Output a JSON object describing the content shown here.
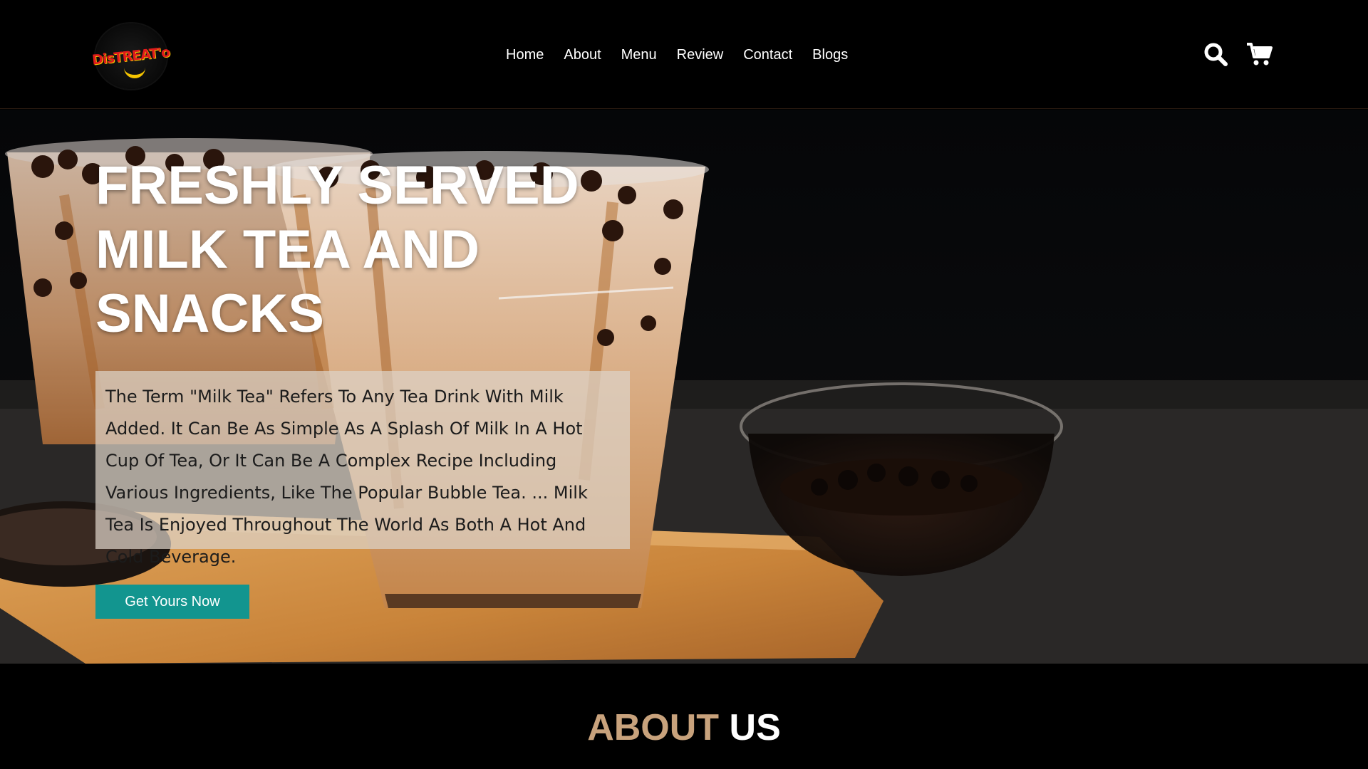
{
  "header": {
    "logo_text": "DisTREAT'o",
    "nav": [
      {
        "label": "Home"
      },
      {
        "label": "About"
      },
      {
        "label": "Menu"
      },
      {
        "label": "Review"
      },
      {
        "label": "Contact"
      },
      {
        "label": "Blogs"
      }
    ],
    "icons": [
      "search-icon",
      "cart-icon"
    ]
  },
  "hero": {
    "title": "FRESHLY SERVED MILK TEA AND SNACKS",
    "description": "The Term \"Milk Tea\" Refers To Any Tea Drink With Milk Added. It Can Be As Simple As A Splash Of Milk In A Hot Cup Of Tea, Or It Can Be A Complex Recipe Including Various Ingredients, Like The Popular Bubble Tea. ... Milk Tea Is Enjoyed Throughout The World As Both A Hot And Cold Beverage.",
    "cta_label": "Get Yours Now"
  },
  "about": {
    "accent": "ABOUT",
    "rest": "US"
  },
  "colors": {
    "accent_teal": "#12958f",
    "about_accent": "#c8a27c",
    "background": "#000000"
  }
}
